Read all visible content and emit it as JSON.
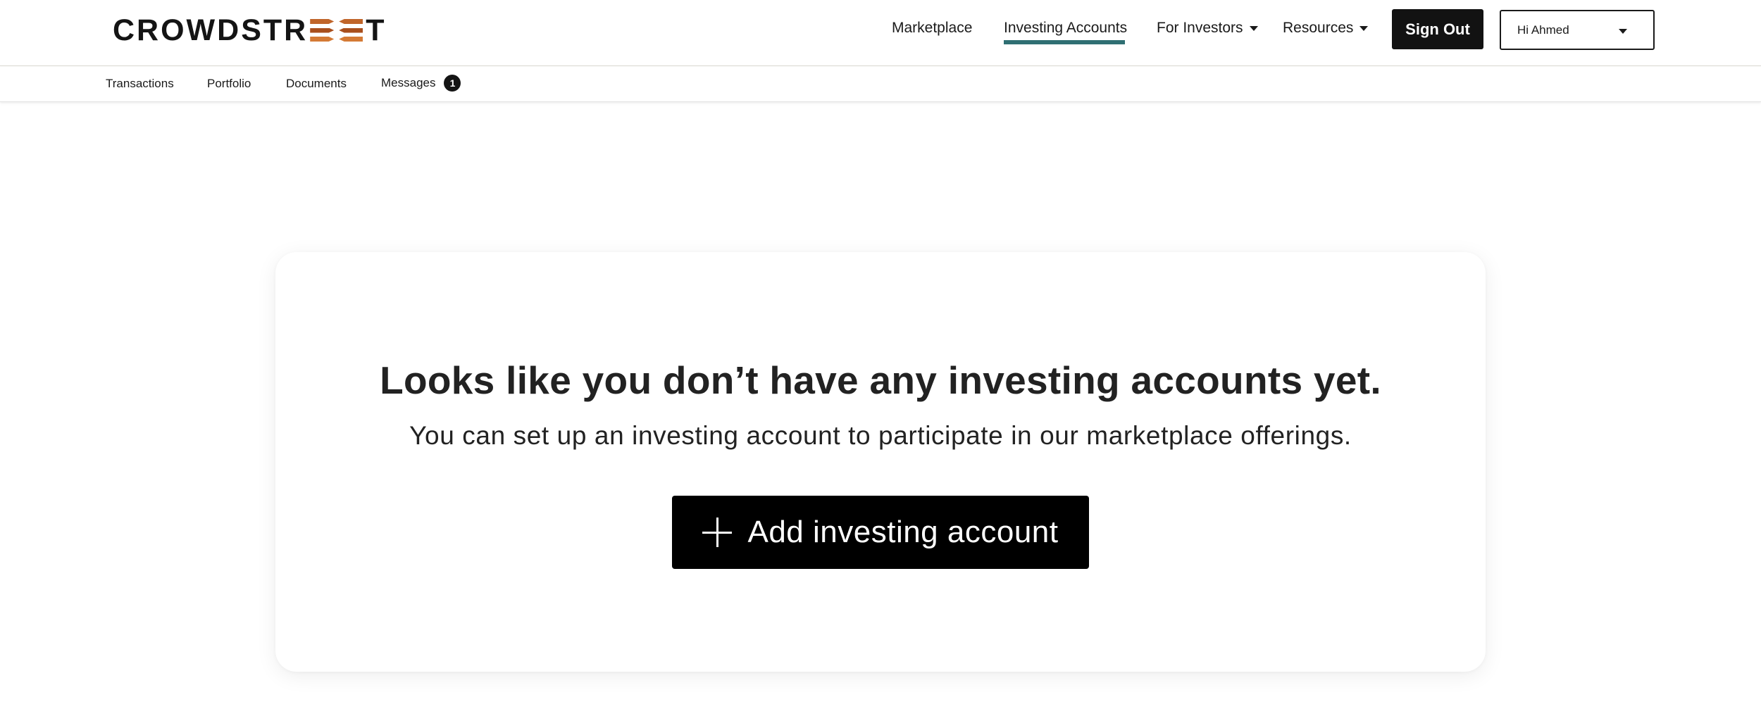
{
  "header": {
    "logo_text_left": "CROWDSTR",
    "logo_text_right": "T",
    "logo_colors": [
      "#c0652a",
      "#a84e1c",
      "#d47a35"
    ],
    "nav": [
      {
        "label": "Marketplace",
        "has_dropdown": false,
        "active": false
      },
      {
        "label": "Investing Accounts",
        "has_dropdown": false,
        "active": true
      },
      {
        "label": "For Investors",
        "has_dropdown": true,
        "active": false
      },
      {
        "label": "Resources",
        "has_dropdown": true,
        "active": false
      }
    ],
    "active_color": "#2f6f73",
    "sign_out_label": "Sign Out",
    "user_greeting": "Hi Ahmed"
  },
  "subnav": {
    "items": [
      {
        "label": "Transactions"
      },
      {
        "label": "Portfolio"
      },
      {
        "label": "Documents"
      },
      {
        "label": "Messages",
        "badge": "1"
      }
    ]
  },
  "empty_state": {
    "title": "Looks like you don’t have any investing accounts yet.",
    "subtitle": "You can set up an investing account to participate in our marketplace offerings.",
    "button_label": "Add investing account",
    "button_icon": "plus-icon"
  }
}
